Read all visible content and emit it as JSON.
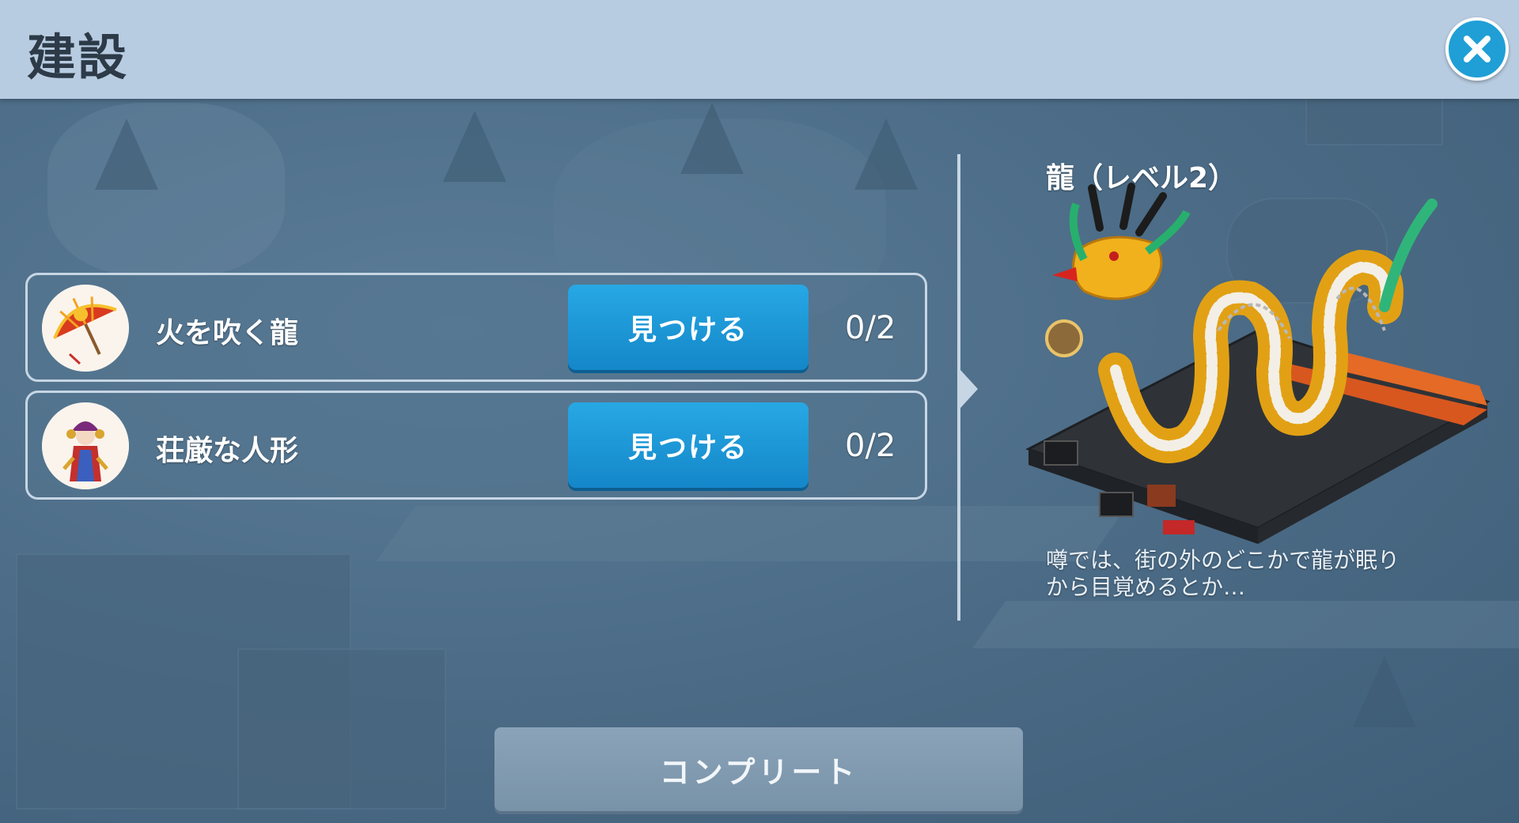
{
  "header": {
    "title": "建設"
  },
  "requirements": [
    {
      "name": "火を吹く龍",
      "button_label": "見つける",
      "progress": "0/2",
      "icon": "umbrella-icon"
    },
    {
      "name": "荘厳な人形",
      "button_label": "見つける",
      "progress": "0/2",
      "icon": "doll-icon"
    }
  ],
  "building": {
    "title": "龍（レベル2）",
    "description": "噂では、街の外のどこかで龍が眠り\nから目覚めるとか…"
  },
  "footer": {
    "complete_label": "コンプリート"
  },
  "colors": {
    "header_bg": "#b8cce1",
    "accent_button": "#1f9fd6",
    "disabled_button": "#8aa3b8"
  }
}
